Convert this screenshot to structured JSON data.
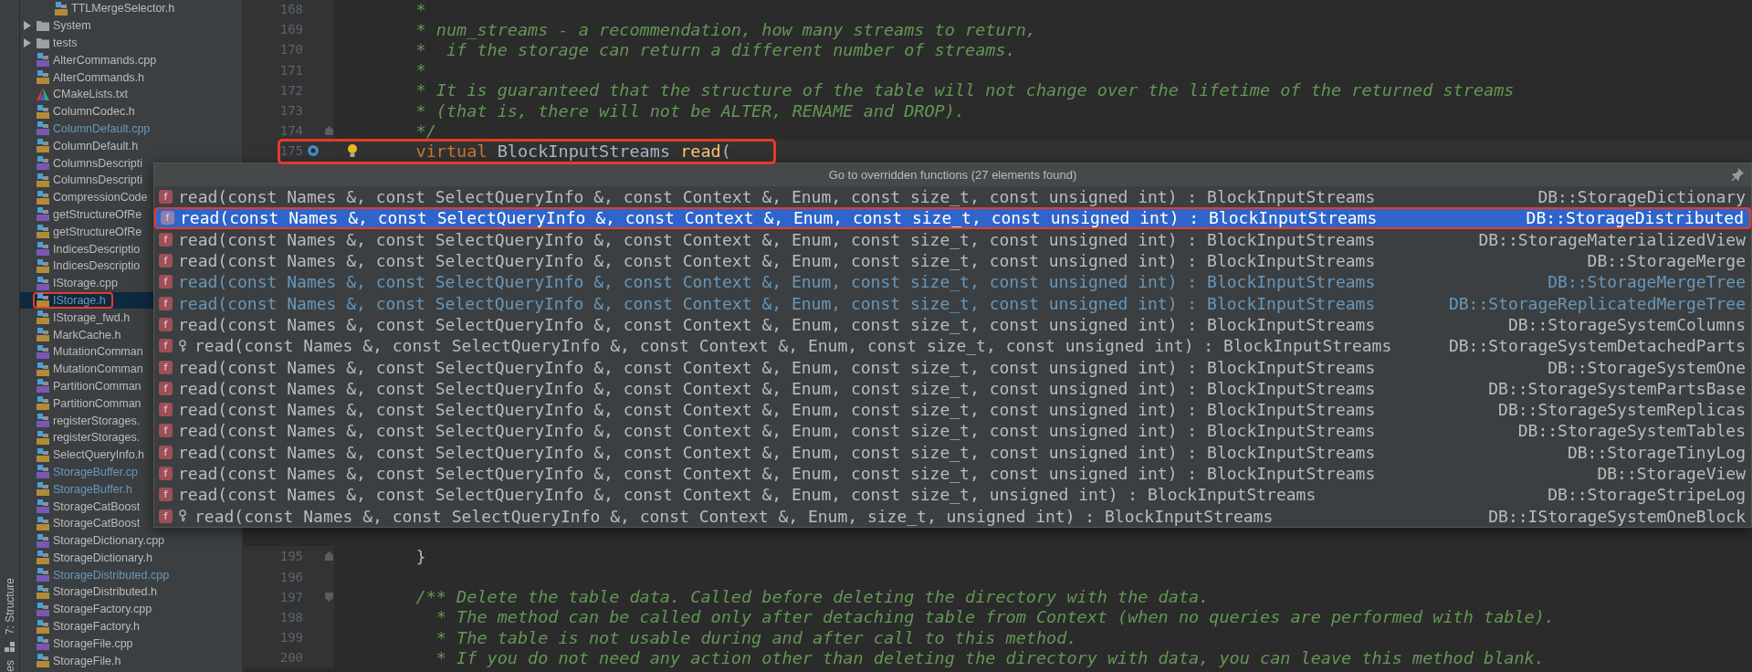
{
  "tool_strip": {
    "tabs": [
      {
        "label": "7: Structure"
      },
      {
        "label": "es"
      }
    ]
  },
  "sidebar": {
    "scrolled_group_children": [
      {
        "name": "TTLMergeSelector.h",
        "kind": "h",
        "modified": false,
        "selected": false
      }
    ],
    "items": [
      {
        "name": "System",
        "kind": "folder",
        "expanded": false,
        "modified": false,
        "selected": false
      },
      {
        "name": "tests",
        "kind": "folder",
        "expanded": false,
        "modified": false,
        "selected": false
      },
      {
        "name": "AlterCommands.cpp",
        "kind": "cpp",
        "modified": false,
        "selected": false
      },
      {
        "name": "AlterCommands.h",
        "kind": "h",
        "modified": false,
        "selected": false
      },
      {
        "name": "CMakeLists.txt",
        "kind": "cmake",
        "modified": false,
        "selected": false
      },
      {
        "name": "ColumnCodec.h",
        "kind": "h",
        "modified": false,
        "selected": false
      },
      {
        "name": "ColumnDefault.cpp",
        "kind": "cpp",
        "modified": true,
        "selected": false
      },
      {
        "name": "ColumnDefault.h",
        "kind": "h",
        "modified": false,
        "selected": false
      },
      {
        "name": "ColumnsDescripti",
        "kind": "cpp",
        "modified": false,
        "selected": false
      },
      {
        "name": "ColumnsDescripti",
        "kind": "h",
        "modified": false,
        "selected": false
      },
      {
        "name": "CompressionCode",
        "kind": "h",
        "modified": false,
        "selected": false
      },
      {
        "name": "getStructureOfRe",
        "kind": "cpp",
        "modified": false,
        "selected": false
      },
      {
        "name": "getStructureOfRe",
        "kind": "h",
        "modified": false,
        "selected": false
      },
      {
        "name": "IndicesDescriptio",
        "kind": "cpp",
        "modified": false,
        "selected": false
      },
      {
        "name": "IndicesDescriptio",
        "kind": "h",
        "modified": false,
        "selected": false
      },
      {
        "name": "IStorage.cpp",
        "kind": "cpp",
        "modified": false,
        "selected": false
      },
      {
        "name": "IStorage.h",
        "kind": "h",
        "modified": true,
        "selected": true,
        "highlighted": true
      },
      {
        "name": "IStorage_fwd.h",
        "kind": "h",
        "modified": false,
        "selected": false
      },
      {
        "name": "MarkCache.h",
        "kind": "h",
        "modified": false,
        "selected": false
      },
      {
        "name": "MutationComman",
        "kind": "cpp",
        "modified": false,
        "selected": false
      },
      {
        "name": "MutationComman",
        "kind": "h",
        "modified": false,
        "selected": false
      },
      {
        "name": "PartitionComman",
        "kind": "cpp",
        "modified": false,
        "selected": false
      },
      {
        "name": "PartitionComman",
        "kind": "h",
        "modified": false,
        "selected": false
      },
      {
        "name": "registerStorages.",
        "kind": "cpp",
        "modified": false,
        "selected": false
      },
      {
        "name": "registerStorages.",
        "kind": "h",
        "modified": false,
        "selected": false
      },
      {
        "name": "SelectQueryInfo.h",
        "kind": "h",
        "modified": false,
        "selected": false
      },
      {
        "name": "StorageBuffer.cp",
        "kind": "cpp",
        "modified": true,
        "selected": false
      },
      {
        "name": "StorageBuffer.h",
        "kind": "h",
        "modified": true,
        "selected": false
      },
      {
        "name": "StorageCatBoost",
        "kind": "cpp",
        "modified": false,
        "selected": false
      },
      {
        "name": "StorageCatBoost",
        "kind": "h",
        "modified": false,
        "selected": false
      },
      {
        "name": "StorageDictionary.cpp",
        "kind": "cpp",
        "modified": false,
        "selected": false
      },
      {
        "name": "StorageDictionary.h",
        "kind": "h",
        "modified": false,
        "selected": false
      },
      {
        "name": "StorageDistributed.cpp",
        "kind": "cpp",
        "modified": true,
        "selected": false
      },
      {
        "name": "StorageDistributed.h",
        "kind": "h",
        "modified": false,
        "selected": false
      },
      {
        "name": "StorageFactory.cpp",
        "kind": "cpp",
        "modified": false,
        "selected": false
      },
      {
        "name": "StorageFactory.h",
        "kind": "h",
        "modified": false,
        "selected": false
      },
      {
        "name": "StorageFile.cpp",
        "kind": "cpp",
        "modified": false,
        "selected": false
      },
      {
        "name": "StorageFile.h",
        "kind": "h",
        "modified": false,
        "selected": false
      }
    ]
  },
  "editor": {
    "lines_before": [
      {
        "number": "168",
        "segments": [
          {
            "kind": "comment",
            "text": "    *"
          }
        ]
      },
      {
        "number": "169",
        "segments": [
          {
            "kind": "comment",
            "text": "    * num_streams - a recommendation, how many streams to return,"
          }
        ]
      },
      {
        "number": "170",
        "segments": [
          {
            "kind": "comment",
            "text": "    *  if the storage can return a different number of streams."
          }
        ]
      },
      {
        "number": "171",
        "segments": [
          {
            "kind": "comment",
            "text": "    *"
          }
        ]
      },
      {
        "number": "172",
        "segments": [
          {
            "kind": "comment",
            "text": "    * It is guaranteed that the structure of the table will not change over the lifetime of the returned streams"
          }
        ]
      },
      {
        "number": "173",
        "segments": [
          {
            "kind": "comment",
            "text": "    * (that is, there will not be ALTER, RENAME and DROP)."
          }
        ]
      },
      {
        "number": "174",
        "fold_end": true,
        "segments": [
          {
            "kind": "comment",
            "text": "    */"
          }
        ]
      },
      {
        "number": "175",
        "current": true,
        "highlighted": true,
        "override_marker": true,
        "intention_bulb": true,
        "segments": [
          {
            "kind": "keyword",
            "text": "    virtual"
          },
          {
            "kind": "plain",
            "text": " BlockInputStreams "
          },
          {
            "kind": "function",
            "text": "read"
          },
          {
            "kind": "plain",
            "text": "("
          }
        ]
      }
    ],
    "lines_after": [
      {
        "number": "195",
        "fold_end": true,
        "segments": [
          {
            "kind": "plain",
            "text": "    }"
          }
        ]
      },
      {
        "number": "196"
      },
      {
        "number": "197",
        "fold_start": true,
        "segments": [
          {
            "kind": "comment",
            "text": "    /** Delete the table data. Called before deleting the directory with the data."
          }
        ]
      },
      {
        "number": "198",
        "segments": [
          {
            "kind": "comment",
            "text": "      * The method can be called only after detaching table from Context (when no queries are performed with table)."
          }
        ]
      },
      {
        "number": "199",
        "segments": [
          {
            "kind": "comment",
            "text": "      * The table is not usable during and after call to this method."
          }
        ]
      },
      {
        "number": "200",
        "segments": [
          {
            "kind": "comment",
            "text": "      * If you do not need any action other than deleting the directory with data, you can leave this method blank."
          }
        ]
      }
    ]
  },
  "popup": {
    "title": "Go to overridden functions (27 elements found)",
    "rows": [
      {
        "kind": "method",
        "badge": "f",
        "signature": "read(const Names &, const SelectQueryInfo &, const Context &, Enum, const size_t, const unsigned int) : BlockInputStreams",
        "class_name": "DB::StorageDictionary",
        "modified": false,
        "selected": false
      },
      {
        "kind": "method",
        "badge": "f",
        "signature": "read(const Names &, const SelectQueryInfo &, const Context &, Enum, const size_t, const unsigned int) : BlockInputStreams",
        "class_name": "DB::StorageDistributed",
        "modified": false,
        "selected": true,
        "highlighted": true
      },
      {
        "kind": "method",
        "badge": "f",
        "signature": "read(const Names &, const SelectQueryInfo &, const Context &, Enum, const size_t, const unsigned int) : BlockInputStreams",
        "class_name": "DB::StorageMaterializedView",
        "modified": false,
        "selected": false
      },
      {
        "kind": "method",
        "badge": "f",
        "signature": "read(const Names &, const SelectQueryInfo &, const Context &, Enum, const size_t, const unsigned int) : BlockInputStreams",
        "class_name": "DB::StorageMerge",
        "modified": false,
        "selected": false
      },
      {
        "kind": "method",
        "badge": "f",
        "signature": "read(const Names &, const SelectQueryInfo &, const Context &, Enum, const size_t, const unsigned int) : BlockInputStreams",
        "class_name": "DB::StorageMergeTree",
        "modified": true,
        "selected": false
      },
      {
        "kind": "method",
        "badge": "f",
        "signature": "read(const Names &, const SelectQueryInfo &, const Context &, Enum, const size_t, const unsigned int) : BlockInputStreams",
        "class_name": "DB::StorageReplicatedMergeTree",
        "modified": true,
        "selected": false
      },
      {
        "kind": "method",
        "badge": "f",
        "signature": "read(const Names &, const SelectQueryInfo &, const Context &, Enum, const size_t, const unsigned int) : BlockInputStreams",
        "class_name": "DB::StorageSystemColumns",
        "modified": false,
        "selected": false
      },
      {
        "kind": "protected-method",
        "badge": "f",
        "signature": "read(const Names &, const SelectQueryInfo &, const Context &, Enum, const size_t, const unsigned int) : BlockInputStreams",
        "class_name": "DB::StorageSystemDetachedParts",
        "modified": false,
        "selected": false
      },
      {
        "kind": "method",
        "badge": "f",
        "signature": "read(const Names &, const SelectQueryInfo &, const Context &, Enum, const size_t, const unsigned int) : BlockInputStreams",
        "class_name": "DB::StorageSystemOne",
        "modified": false,
        "selected": false
      },
      {
        "kind": "method",
        "badge": "f",
        "signature": "read(const Names &, const SelectQueryInfo &, const Context &, Enum, const size_t, const unsigned int) : BlockInputStreams",
        "class_name": "DB::StorageSystemPartsBase",
        "modified": false,
        "selected": false
      },
      {
        "kind": "method",
        "badge": "f",
        "signature": "read(const Names &, const SelectQueryInfo &, const Context &, Enum, const size_t, const unsigned int) : BlockInputStreams",
        "class_name": "DB::StorageSystemReplicas",
        "modified": false,
        "selected": false
      },
      {
        "kind": "method",
        "badge": "f",
        "signature": "read(const Names &, const SelectQueryInfo &, const Context &, Enum, const size_t, const unsigned int) : BlockInputStreams",
        "class_name": "DB::StorageSystemTables",
        "modified": false,
        "selected": false
      },
      {
        "kind": "method",
        "badge": "f",
        "signature": "read(const Names &, const SelectQueryInfo &, const Context &, Enum, const size_t, const unsigned int) : BlockInputStreams",
        "class_name": "DB::StorageTinyLog",
        "modified": false,
        "selected": false
      },
      {
        "kind": "method",
        "badge": "f",
        "signature": "read(const Names &, const SelectQueryInfo &, const Context &, Enum, const size_t, const unsigned int) : BlockInputStreams",
        "class_name": "DB::StorageView",
        "modified": false,
        "selected": false
      },
      {
        "kind": "method",
        "badge": "f",
        "signature": "read(const Names &, const SelectQueryInfo &, const Context &, Enum, const size_t, unsigned int) : BlockInputStreams",
        "class_name": "DB::StorageStripeLog",
        "modified": false,
        "selected": false
      },
      {
        "kind": "protected-method",
        "badge": "f",
        "signature": "read(const Names &, const SelectQueryInfo &, const Context &, Enum, size_t, unsigned int) : BlockInputStreams",
        "class_name": "DB::IStorageSystemOneBlock",
        "modified": false,
        "selected": false
      }
    ]
  }
}
